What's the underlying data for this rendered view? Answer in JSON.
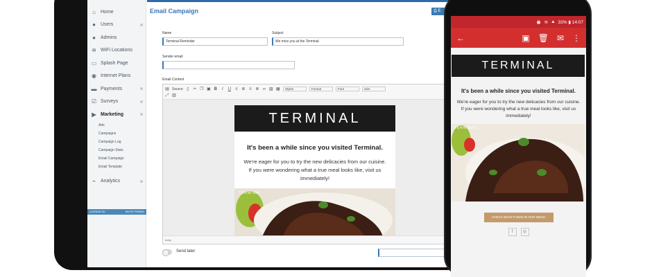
{
  "sidebar": {
    "items": [
      {
        "label": "Home",
        "icon": "home-icon",
        "glyph": "⌂",
        "dot": false
      },
      {
        "label": "Users",
        "icon": "user-icon",
        "glyph": "●",
        "dot": true
      },
      {
        "label": "Admins",
        "icon": "admin-icon",
        "glyph": "●",
        "dot": false
      },
      {
        "label": "WiFi Locations",
        "icon": "wifi-icon",
        "glyph": "≋",
        "dot": false
      },
      {
        "label": "Splash Page",
        "icon": "page-icon",
        "glyph": "▭",
        "dot": false
      },
      {
        "label": "Internet Plans",
        "icon": "globe-icon",
        "glyph": "◉",
        "dot": false
      },
      {
        "label": "Payments",
        "icon": "card-icon",
        "glyph": "▬",
        "dot": true
      },
      {
        "label": "Surveys",
        "icon": "checkbox-icon",
        "glyph": "☑",
        "dot": true
      },
      {
        "label": "Marketing",
        "icon": "play-icon",
        "glyph": "▶",
        "dot": true,
        "active": true
      }
    ],
    "sub": [
      "Ads",
      "Campaigns",
      "Campaign Log",
      "Campaign Stats",
      "Email Campaign",
      "Email Template"
    ],
    "analytics": {
      "label": "Analytics",
      "glyph": "⌁"
    },
    "footer_left": "LICENSE OK",
    "footer_right": "INVITE FRIEND"
  },
  "main": {
    "title": "Email Campaign",
    "top_button": "⎙ E",
    "name_label": "Name",
    "name_value": "Terminal Reminder",
    "subject_label": "Subject",
    "subject_value": "We miss you at the Terminal",
    "sender_label": "Sender email",
    "sender_value": "",
    "content_label": "Email Content",
    "toolbar": {
      "source": "Source",
      "styles": "Styles",
      "format": "Format",
      "font": "Font",
      "size": "Size"
    },
    "status": "body",
    "send_later": "Send later"
  },
  "email": {
    "logo": "TERMINAL",
    "heading": "It's been a while since you visited Terminal.",
    "line1": "We're eager for you to try the new delicacies from our cuisine.",
    "line2": "If you were wondering what a true meal looks like, visit us immediately!",
    "food_caption": "TERMINAL",
    "button": "CHECK WHAT'S NEW IN OUR MENU"
  },
  "phone": {
    "status": "33% ▮ 14:07",
    "back": "←"
  },
  "colors": {
    "accent": "#3c78b4",
    "phone_bar": "#d32f2f",
    "button": "#c49a6c"
  }
}
